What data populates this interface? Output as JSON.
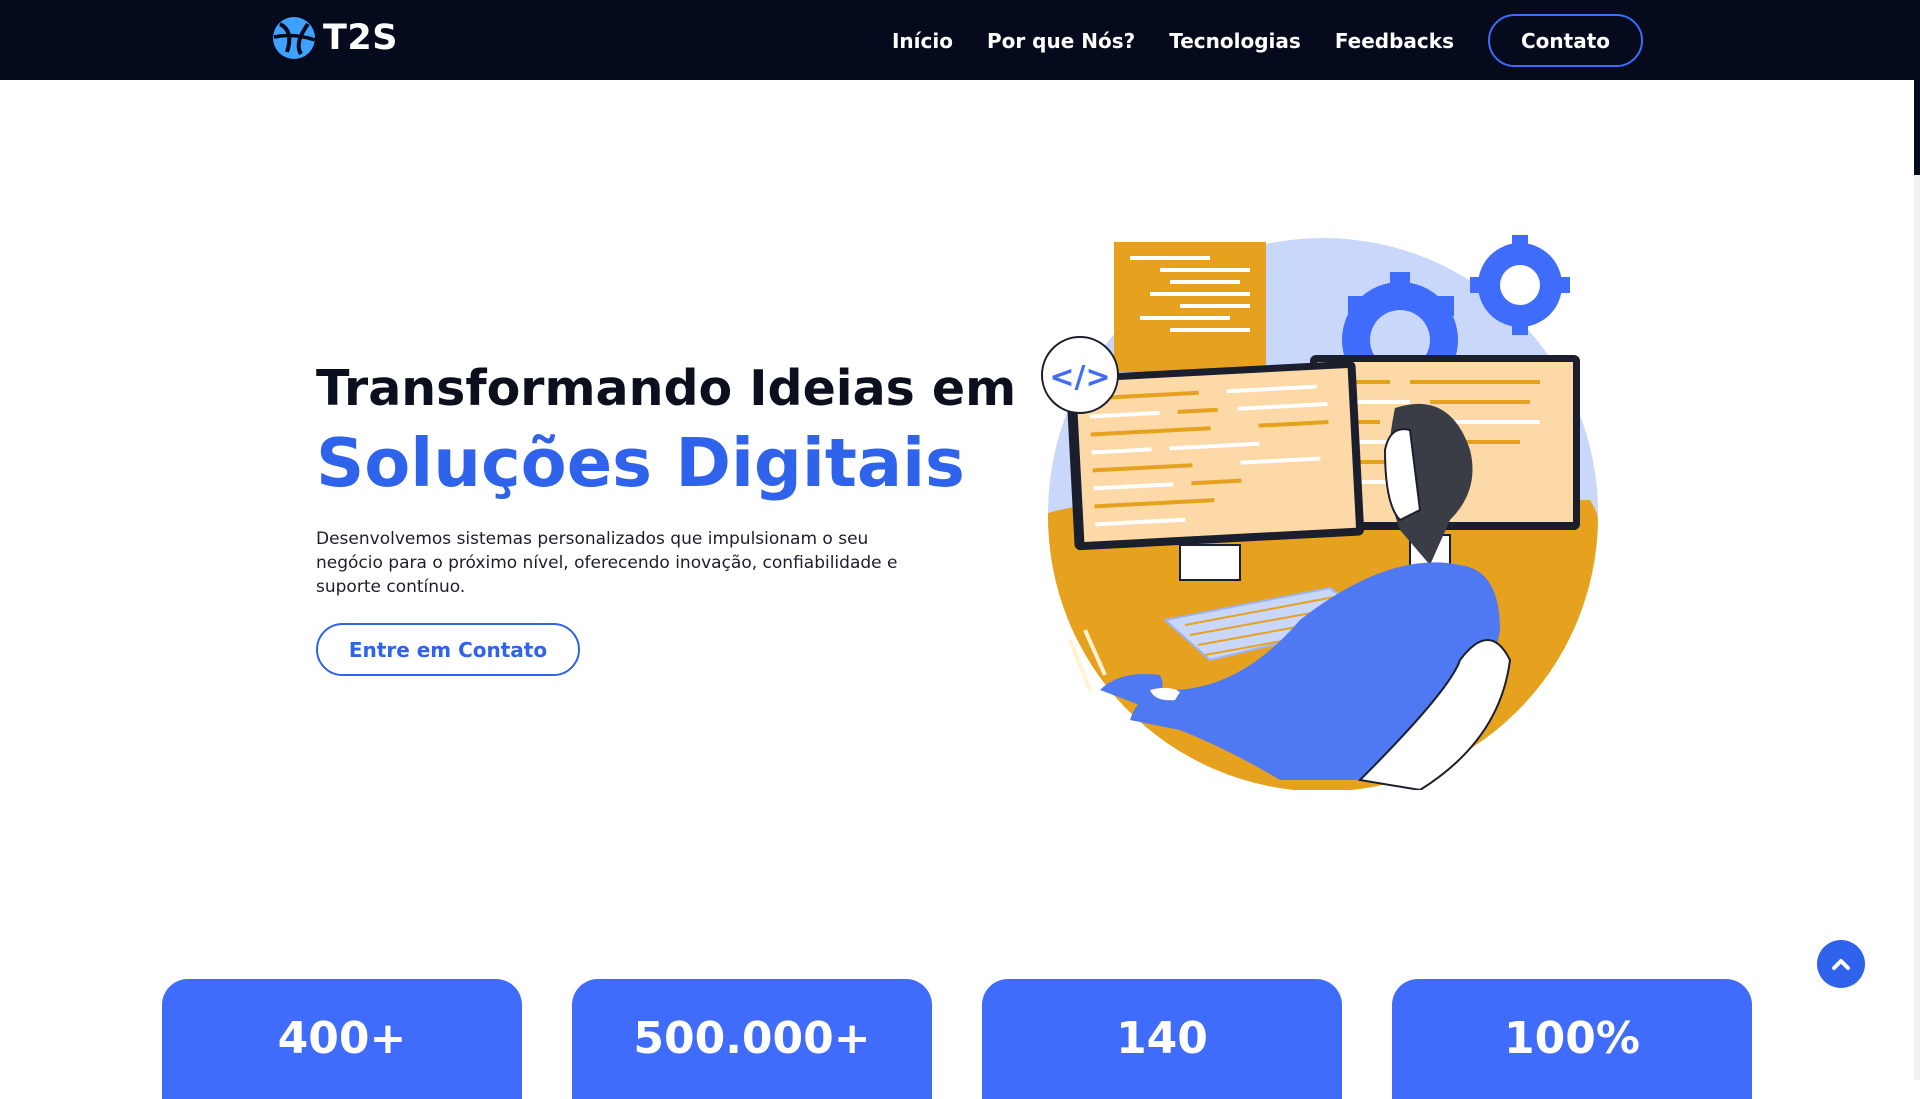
{
  "brand": {
    "name": "T2S"
  },
  "nav": {
    "links": [
      "Início",
      "Por que Nós?",
      "Tecnologias",
      "Feedbacks"
    ],
    "cta": "Contato"
  },
  "hero": {
    "title_line1": "Transformando Ideias em",
    "title_line2": "Soluções Digitais",
    "description": "Desenvolvemos sistemas personalizados que impulsionam o seu negócio para o próximo nível, oferecendo inovação, confiabilidade e suporte contínuo.",
    "cta": "Entre em Contato"
  },
  "illustration": {
    "code_tag": "</>"
  },
  "stats": [
    "400+",
    "500.000+",
    "140",
    "100%"
  ],
  "colors": {
    "navbar": "#050a1c",
    "accent_blue": "#2f63eb",
    "card_blue": "#3f6cfb",
    "illustration_orange": "#e6a21e"
  },
  "icons": [
    "logo-icon",
    "code-tag-icon",
    "gear-icon",
    "chevron-up-icon"
  ]
}
